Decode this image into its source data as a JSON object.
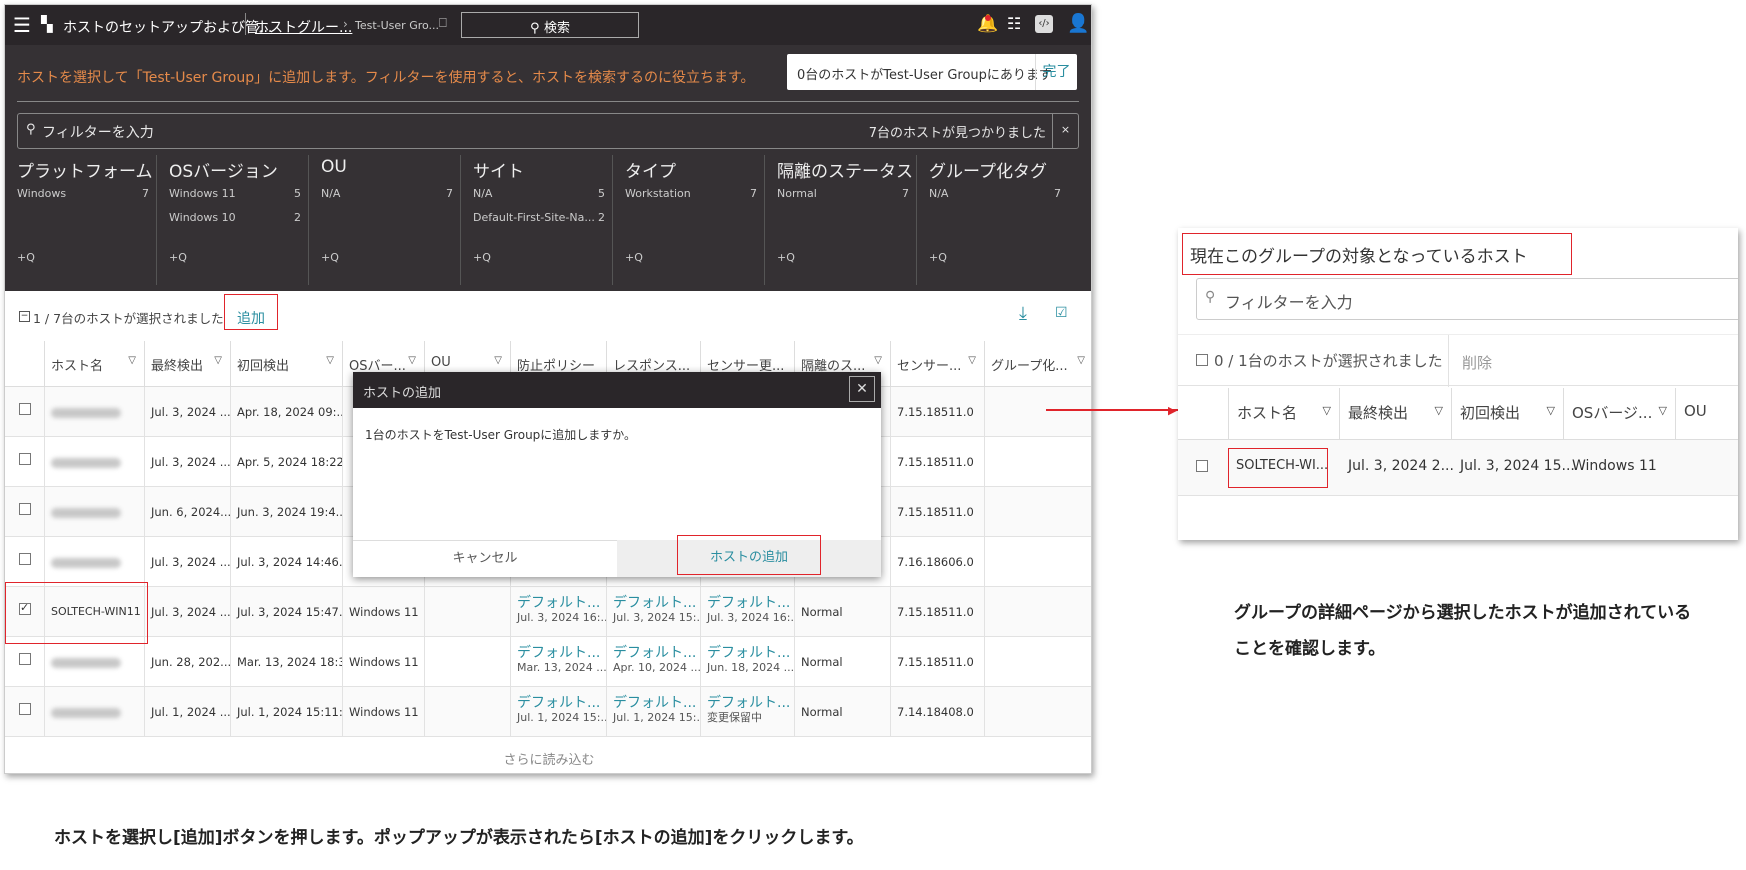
{
  "topbar": {
    "menu_icon": "hamburger-icon",
    "app_icon": "grid-icon",
    "breadcrumb_root": "ホストのセットアップおよび管...",
    "breadcrumb_mid": "ホストグルー...",
    "breadcrumb_leaf": "Test-User Gro...",
    "search_label": "検索"
  },
  "instruction": "ホストを選択して「Test-User Group」に追加します。フィルターを使用すると、ホストを検索するのに役立ちます。",
  "host_count_text": "0台のホストがTest-User Groupにあります",
  "done_label": "完了",
  "filter": {
    "placeholder": "フィルターを入力",
    "found": "7台のホストが見つかりました",
    "clear": "×"
  },
  "facets": [
    {
      "title": "プラットフォーム",
      "rows": [
        {
          "label": "Windows",
          "count": "7"
        }
      ]
    },
    {
      "title": "OSバージョン",
      "rows": [
        {
          "label": "Windows 11",
          "count": "5"
        },
        {
          "label": "Windows 10",
          "count": "2"
        }
      ]
    },
    {
      "title": "OU",
      "rows": [
        {
          "label": "N/A",
          "count": "7"
        }
      ]
    },
    {
      "title": "サイト",
      "rows": [
        {
          "label": "N/A",
          "count": "5"
        },
        {
          "label": "Default-First-Site-Na...",
          "count": "2"
        }
      ]
    },
    {
      "title": "タイプ",
      "rows": [
        {
          "label": "Workstation",
          "count": "7"
        }
      ]
    },
    {
      "title": "隔離のステータス",
      "rows": [
        {
          "label": "Normal",
          "count": "7"
        }
      ]
    },
    {
      "title": "グループ化タグ",
      "rows": [
        {
          "label": "N/A",
          "count": "7"
        }
      ]
    }
  ],
  "facet_add": "+Q",
  "toolbar": {
    "selected": "1 / 7台のホストが選択されました",
    "add": "追加"
  },
  "columns": [
    "ホスト名",
    "最終検出",
    "初回検出",
    "OSバー...",
    "OU",
    "防止ポリシー",
    "レスポンス...",
    "センサー更...",
    "隔離のス...",
    "センサー...",
    "グループ化..."
  ],
  "rows": [
    {
      "host": "",
      "last": "Jul. 3, 2024 ...",
      "first": "Apr. 18, 2024 09:...",
      "os": "",
      "prev": "",
      "prev_sub": "",
      "resp": "",
      "resp_sub": "",
      "sens": "",
      "sens_sub": "",
      "iso": "",
      "ver": "7.15.18511.0",
      "checked": false
    },
    {
      "host": "",
      "last": "Jul. 3, 2024 ...",
      "first": "Apr. 5, 2024 18:22...",
      "os": "",
      "prev": "",
      "prev_sub": "",
      "resp": "",
      "resp_sub": "",
      "sens": "",
      "sens_sub": "",
      "iso": "",
      "ver": "7.15.18511.0",
      "checked": false
    },
    {
      "host": "",
      "last": "Jun. 6, 2024...",
      "first": "Jun. 3, 2024 19:4...",
      "os": "",
      "prev": "",
      "prev_sub": "",
      "resp": "",
      "resp_sub": "",
      "sens": "",
      "sens_sub": "",
      "iso": "",
      "ver": "7.15.18511.0",
      "checked": false
    },
    {
      "host": "",
      "last": "Jul. 3, 2024 ...",
      "first": "Jul. 3, 2024 14:46...",
      "os": "",
      "prev": "",
      "prev_sub": "",
      "resp": "",
      "resp_sub": "",
      "sens": "",
      "sens_sub": "",
      "iso": "",
      "ver": "7.16.18606.0",
      "checked": false
    },
    {
      "host": "SOLTECH-WIN11",
      "last": "Jul. 3, 2024 ...",
      "first": "Jul. 3, 2024 15:47...",
      "os": "Windows 11",
      "prev": "デフォルト...",
      "prev_sub": "Jul. 3, 2024 16:...",
      "resp": "デフォルト...",
      "resp_sub": "Jul. 3, 2024 15:...",
      "sens": "デフォルト...",
      "sens_sub": "Jul. 3, 2024 16:...",
      "iso": "Normal",
      "ver": "7.15.18511.0",
      "checked": true
    },
    {
      "host": "",
      "last": "Jun. 28, 202...",
      "first": "Mar. 13, 2024 18:3...",
      "os": "Windows 11",
      "prev": "デフォルト...",
      "prev_sub": "Mar. 13, 2024 ...",
      "resp": "デフォルト...",
      "resp_sub": "Apr. 10, 2024 ...",
      "sens": "デフォルト...",
      "sens_sub": "Jun. 18, 2024 ...",
      "iso": "Normal",
      "ver": "7.15.18511.0",
      "checked": false
    },
    {
      "host": "",
      "last": "Jul. 1, 2024 ...",
      "first": "Jul. 1, 2024 15:11:...",
      "os": "Windows 11",
      "prev": "デフォルト...",
      "prev_sub": "Jul. 1, 2024 15:...",
      "resp": "デフォルト...",
      "resp_sub": "Jul. 1, 2024 15:...",
      "sens": "デフォルト...",
      "sens_sub": "変更保留中",
      "iso": "Normal",
      "ver": "7.14.18408.0",
      "checked": false
    }
  ],
  "load_more": "さらに読み込む",
  "modal": {
    "title": "ホストの追加",
    "body": "1台のホストをTest-User Groupに追加しますか。",
    "cancel": "キャンセル",
    "confirm": "ホストの追加"
  },
  "right": {
    "title": "現在このグループの対象となっているホスト",
    "filter_placeholder": "フィルターを入力",
    "selected": "0 / 1台のホストが選択されました",
    "delete": "削除",
    "columns": [
      "ホスト名",
      "最終検出",
      "初回検出",
      "OSバージ...",
      "OU"
    ],
    "row": {
      "host": "SOLTECH-WI...",
      "last": "Jul. 3, 2024 2...",
      "first": "Jul. 3, 2024 15...",
      "os": "Windows 11"
    }
  },
  "caption_left": "ホストを選択し[追加]ボタンを押します。ポップアップが表示されたら[ホストの追加]をクリックします。",
  "caption_right": [
    "グループの詳細ページから選択したホストが追加されている",
    "ことを確認します。"
  ]
}
